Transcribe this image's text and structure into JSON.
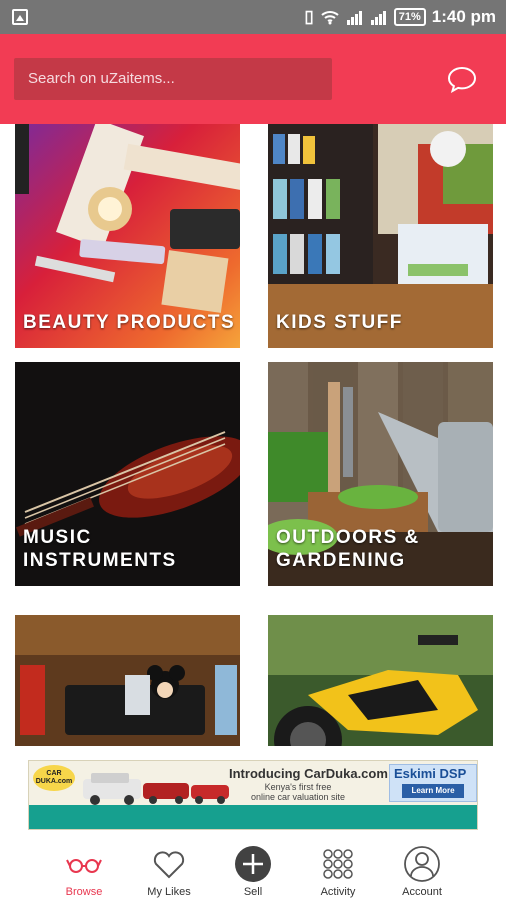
{
  "status_bar": {
    "battery": "71",
    "time": "1:40 pm",
    "icons": [
      "image-icon",
      "vibrate-icon",
      "wifi-icon",
      "signal-icon",
      "signal-icon",
      "battery-icon"
    ]
  },
  "header": {
    "search_placeholder": "Search on uZaitems...",
    "chat_icon": "chat-bubble-icon",
    "color": "#f23c54"
  },
  "categories": [
    {
      "label": "BEAUTY PRODUCTS"
    },
    {
      "label": "KIDS STUFF"
    },
    {
      "label": "MUSIC INSTRUMENTS"
    },
    {
      "label": "OUTDOORS & GARDENING"
    },
    {
      "label": ""
    },
    {
      "label": ""
    }
  ],
  "ad": {
    "logo_text": "CAR DUKA.com",
    "headline": "Introducing CarDuka.com",
    "subline1": "Kenya's first free",
    "subline2": "online car valuation site",
    "eskimi": "Eskimi DSP",
    "learn_more": "Learn More"
  },
  "bottom_nav": {
    "active_color": "#e8374f",
    "items": [
      {
        "label": "Browse",
        "icon": "glasses-icon"
      },
      {
        "label": "My Likes",
        "icon": "heart-icon"
      },
      {
        "label": "Sell",
        "icon": "plus-circle-icon"
      },
      {
        "label": "Activity",
        "icon": "grid-dots-icon"
      },
      {
        "label": "Account",
        "icon": "user-circle-icon"
      }
    ]
  }
}
